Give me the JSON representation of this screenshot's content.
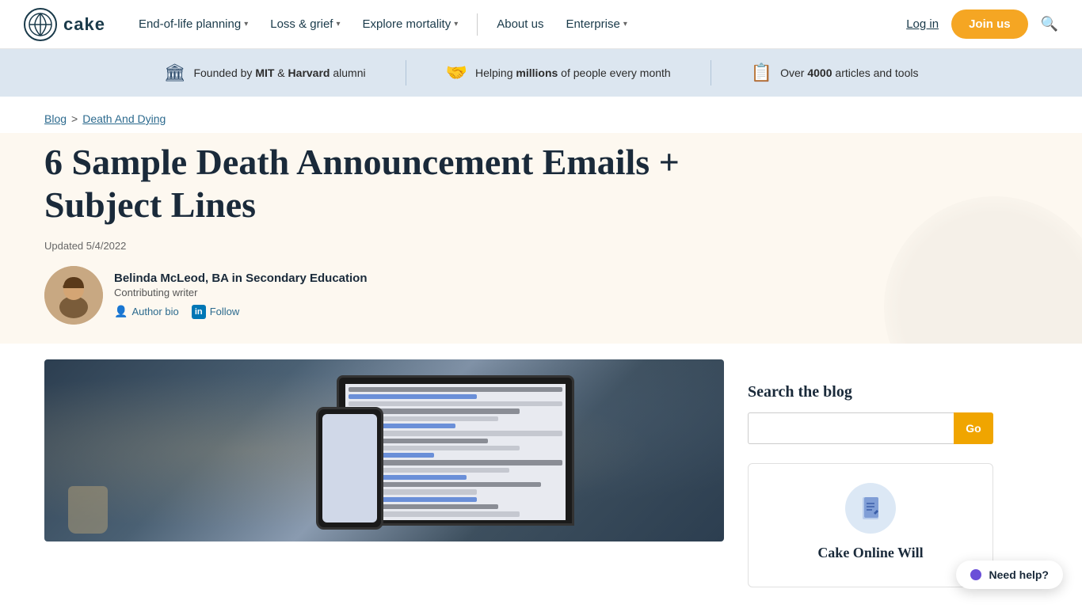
{
  "brand": {
    "name": "cake",
    "logo_alt": "cake logo"
  },
  "nav": {
    "links": [
      {
        "label": "End-of-life planning",
        "has_dropdown": true
      },
      {
        "label": "Loss & grief",
        "has_dropdown": true
      },
      {
        "label": "Explore mortality",
        "has_dropdown": true
      },
      {
        "label": "About us",
        "has_dropdown": false
      },
      {
        "label": "Enterprise",
        "has_dropdown": true
      }
    ],
    "login_label": "Log in",
    "join_label": "Join us",
    "search_placeholder": "Search"
  },
  "trust_bar": {
    "items": [
      {
        "icon": "🏛",
        "text_before": "Founded by ",
        "bold": "MIT",
        "text_mid": " & ",
        "bold2": "Harvard",
        "text_after": " alumni"
      },
      {
        "icon": "🤝",
        "text_before": "Helping ",
        "bold": "millions",
        "text_after": " of people every month"
      },
      {
        "icon": "📋",
        "text_before": "Over ",
        "bold": "4000",
        "text_after": " articles and tools"
      }
    ]
  },
  "breadcrumb": {
    "blog_label": "Blog",
    "separator": ">",
    "current_label": "Death And Dying"
  },
  "article": {
    "title": "6 Sample Death Announcement Emails + Subject Lines",
    "updated_label": "Updated 5/4/2022",
    "author": {
      "name": "Belinda McLeod, BA in Secondary Education",
      "role": "Contributing writer",
      "bio_label": "Author bio",
      "follow_label": "Follow"
    }
  },
  "sidebar": {
    "search_title": "Search the blog",
    "search_placeholder": "",
    "search_button_label": "Go",
    "card": {
      "title": "Cake Online Will",
      "icon": "📄"
    }
  },
  "chat": {
    "label": "Need help?"
  }
}
